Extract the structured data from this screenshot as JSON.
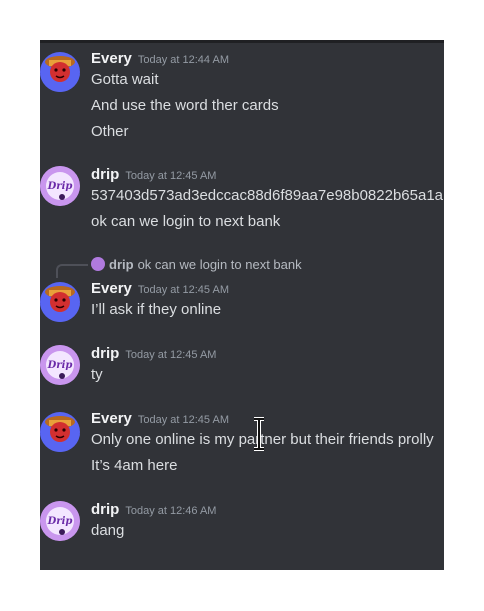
{
  "messages": [
    {
      "author": "Every",
      "timestamp": "Today at 12:44 AM",
      "lines": [
        "Gotta wait",
        "And use the word ther cards",
        "Other"
      ]
    },
    {
      "author": "drip",
      "timestamp": "Today at 12:45 AM",
      "lines": [
        "537403d573ad3edccac88d6f89aa7e98b0822b65a1a",
        "ok can we login to next bank"
      ]
    },
    {
      "author": "Every",
      "timestamp": "Today at 12:45 AM",
      "reply_to": {
        "author": "drip",
        "text": "ok can we login to next bank"
      },
      "lines": [
        "I’ll ask if they online"
      ]
    },
    {
      "author": "drip",
      "timestamp": "Today at 12:45 AM",
      "lines": [
        "ty"
      ]
    },
    {
      "author": "Every",
      "timestamp": "Today at 12:45 AM",
      "lines": [
        "Only one online is my partner but their friends prolly",
        "It’s 4am here"
      ]
    },
    {
      "author": "drip",
      "timestamp": "Today at 12:46 AM",
      "lines": [
        "dang"
      ]
    }
  ],
  "avatars": {
    "every": {
      "icon": "red-mask-face-icon",
      "color": "#5865f2"
    },
    "drip": {
      "icon": "drip-logo-icon",
      "color": "#b07adf"
    }
  },
  "colors": {
    "background": "#313338",
    "author": "#f2f3f5",
    "timestamp": "#949ba4",
    "text": "#dbdee1"
  },
  "cursor": "text-cursor-icon"
}
